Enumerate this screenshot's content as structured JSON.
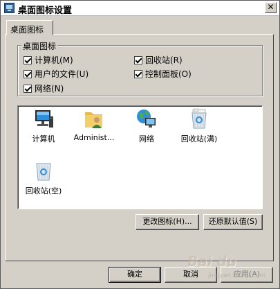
{
  "window": {
    "title": "桌面图标设置",
    "close_glyph": "✕"
  },
  "tab": {
    "label": "桌面图标"
  },
  "group": {
    "title": "桌面图标",
    "checkboxes": [
      {
        "label": "计算机(M)",
        "checked": true
      },
      {
        "label": "回收站(R)",
        "checked": true
      },
      {
        "label": "用户的文件(U)",
        "checked": true
      },
      {
        "label": "控制面板(O)",
        "checked": true
      },
      {
        "label": "网络(N)",
        "checked": true
      }
    ]
  },
  "icons": [
    {
      "label": "计算机",
      "icon": "computer-icon"
    },
    {
      "label": "Administ...",
      "icon": "user-folder-icon"
    },
    {
      "label": "网络",
      "icon": "network-icon"
    },
    {
      "label": "回收站(满)",
      "icon": "recycle-bin-full-icon"
    },
    {
      "label": "回收站(空)",
      "icon": "recycle-bin-empty-icon"
    }
  ],
  "buttons": {
    "change_icon": "更改图标(H)...",
    "restore_default": "还原默认值(S)",
    "ok": "确定",
    "cancel": "取消",
    "apply": "应用(A)"
  },
  "watermark": {
    "text": "Bai du",
    "sub": "jingyan.baidu.com"
  }
}
